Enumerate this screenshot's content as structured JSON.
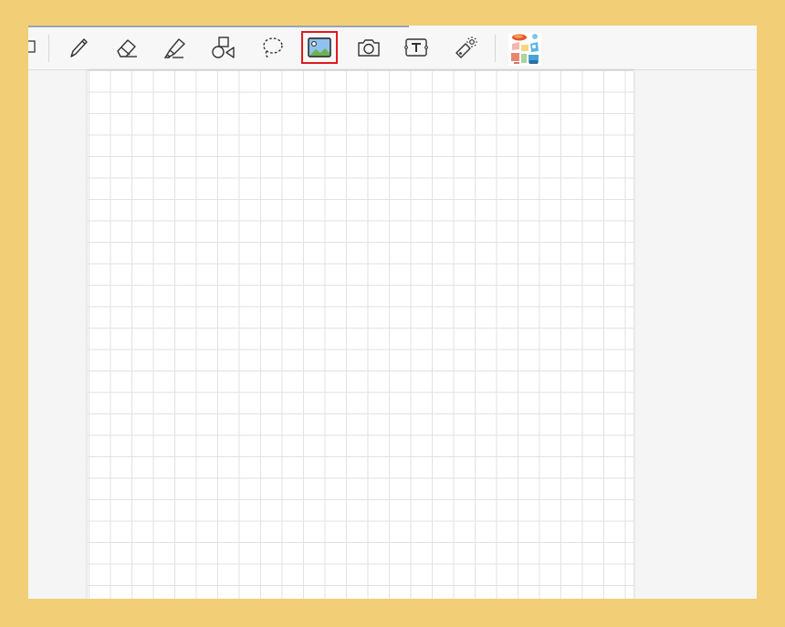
{
  "app": {
    "background_color": "#F2CF76",
    "canvas_color": "#F5F5F5",
    "selected_outline_color": "#E0191F"
  },
  "toolbar": {
    "tools": [
      {
        "name": "pen",
        "icon": "pen-icon",
        "selected": false
      },
      {
        "name": "eraser",
        "icon": "eraser-icon",
        "selected": false
      },
      {
        "name": "highlighter",
        "icon": "highlighter-icon",
        "selected": false
      },
      {
        "name": "shapes",
        "icon": "shapes-icon",
        "selected": false
      },
      {
        "name": "lasso",
        "icon": "lasso-icon",
        "selected": false
      },
      {
        "name": "image",
        "icon": "image-icon",
        "selected": true
      },
      {
        "name": "camera",
        "icon": "camera-icon",
        "selected": false
      },
      {
        "name": "text",
        "icon": "text-box-icon",
        "selected": false
      },
      {
        "name": "laser-pointer",
        "icon": "laser-pointer-icon",
        "selected": false
      },
      {
        "name": "stickers",
        "icon": "sticker-pack-icon",
        "selected": false
      }
    ]
  },
  "page": {
    "paper_style": "grid"
  }
}
